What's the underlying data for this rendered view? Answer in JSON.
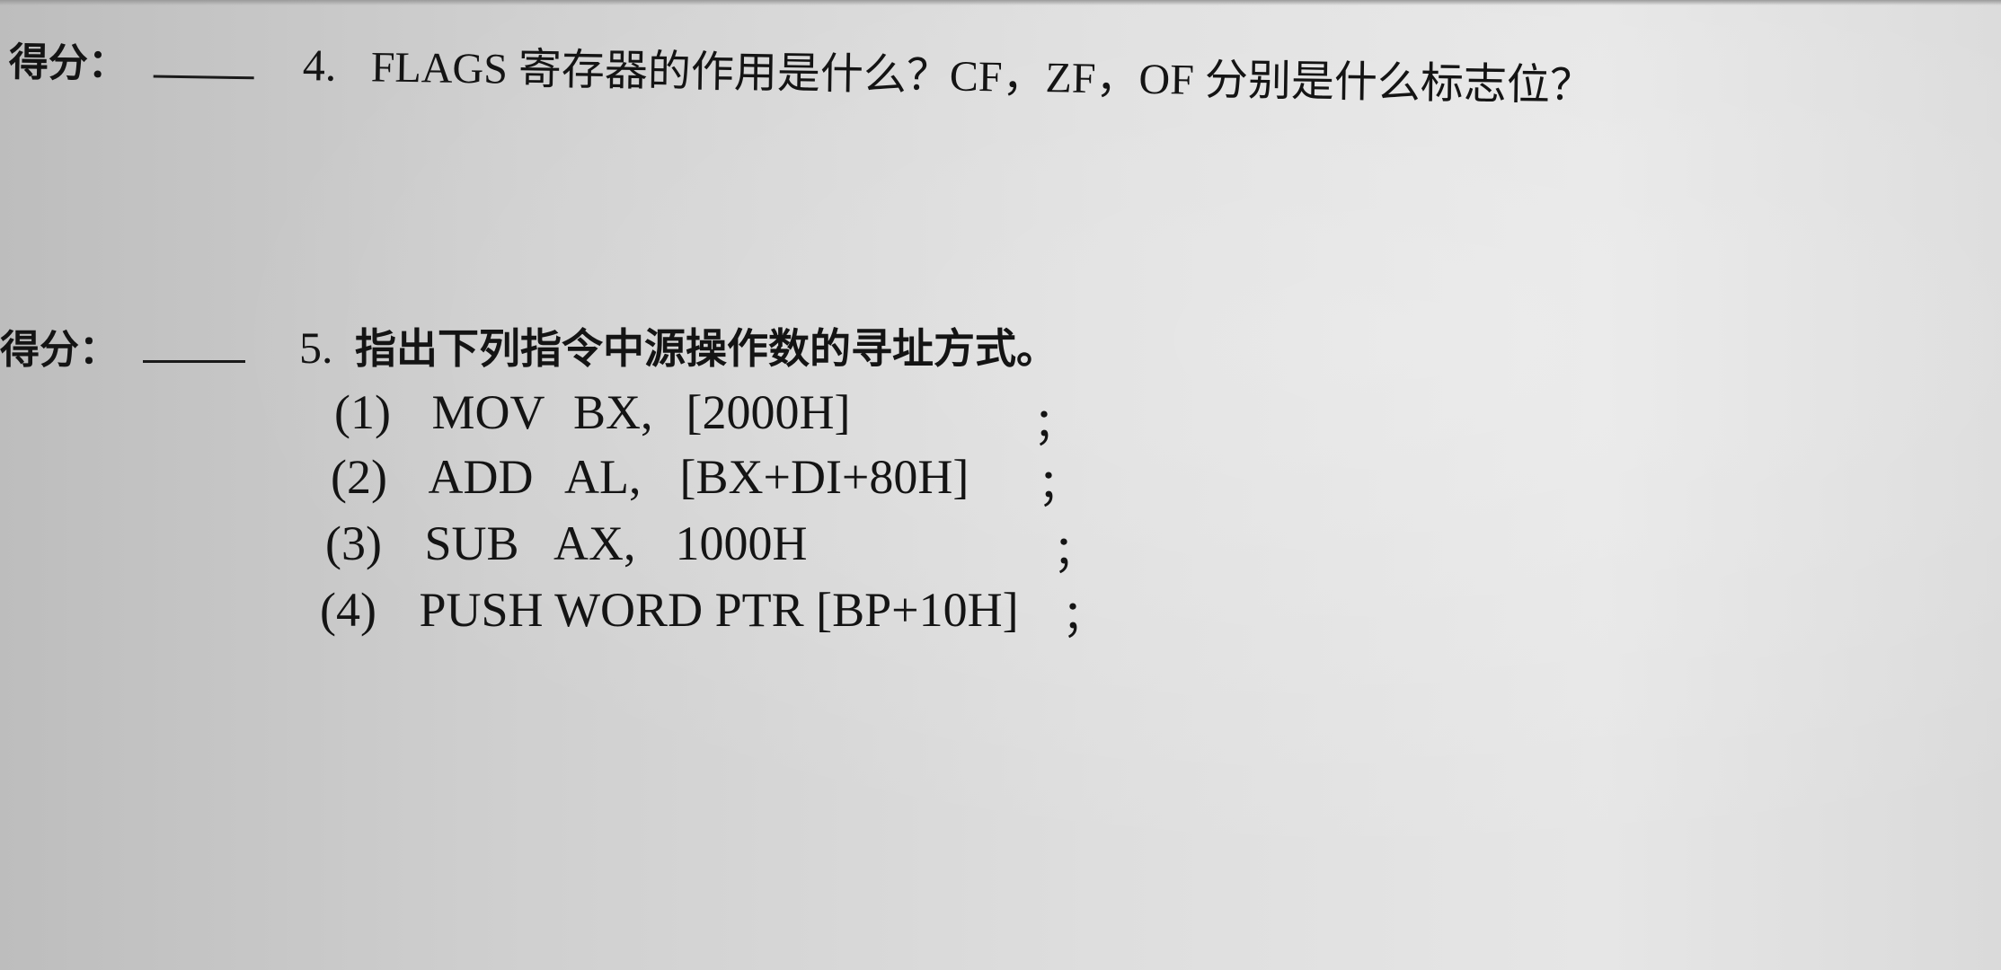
{
  "score_label": "得分：",
  "question4": {
    "number": "4.",
    "text": "FLAGS 寄存器的作用是什么？CF，ZF，OF 分别是什么标志位？"
  },
  "question5": {
    "number": "5.",
    "text": "指出下列指令中源操作数的寻址方式。",
    "items": [
      {
        "index": "(1)",
        "op": "MOV",
        "dest": "BX,",
        "src": "[2000H]",
        "end": "；"
      },
      {
        "index": "(2)",
        "op": "ADD",
        "dest": "AL,",
        "src": "[BX+DI+80H]",
        "end": "；"
      },
      {
        "index": "(3)",
        "op": "SUB",
        "dest": "AX,",
        "src": "1000H",
        "end": "；"
      },
      {
        "index": "(4)",
        "op": "PUSH WORD PTR [BP+10H]",
        "dest": "",
        "src": "",
        "end": "；"
      }
    ]
  }
}
